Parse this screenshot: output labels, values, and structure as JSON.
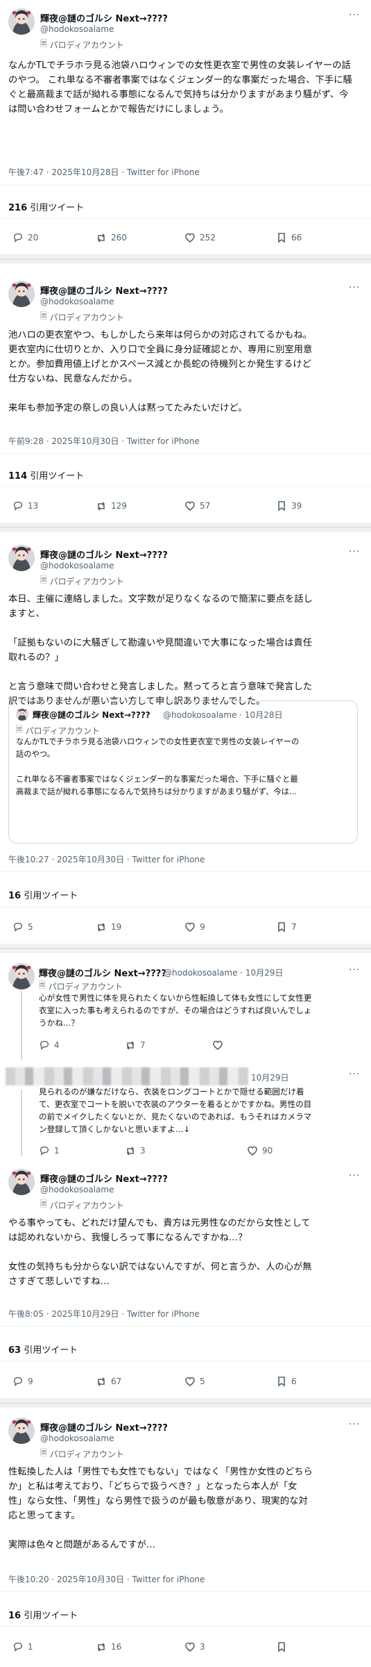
{
  "account": {
    "name": "輝夜@謎のゴルシ Next→????",
    "handle": "@hodokosoalame",
    "label": "パロディアカウント"
  },
  "tweets": [
    {
      "text": "なんかTLでチラホラ見る池袋ハロウィンでの女性更衣室で男性の女装レイヤーの話のやつ。\n\nこれ単なる不審者事案ではなくジェンダー的な事案だった場合、下手に騒ぐと最高裁まで話が拗れる事態になるんで気持ちは分かりますがあまり騒がず、今は問い合わせフォームとかで報告だけにしましょう。",
      "meta": "午後7:47 · 2025年10月28日 · Twitter for iPhone",
      "quotes_count": "216",
      "quotes_label": "引用ツイート",
      "replies": "20",
      "retweets": "260",
      "likes": "252",
      "bookmarks": "66"
    },
    {
      "text": "池ハロの更衣室やつ、もしかしたら来年は何らかの対応されてるかもね。\n更衣室内に仕切りとか、入り口で全員に身分証確認とか、専用に別室用意\nとか。参加費用値上げとかスペース減とか長蛇の待機列とか発生するけど\n仕方ないね、民意なんだから。\n\n来年も参加予定の祭しの良い人は黙ってたみたいだけど。",
      "meta": "午前9:28 · 2025年10月30日 · Twitter for iPhone",
      "quotes_count": "114",
      "quotes_label": "引用ツイート",
      "replies": "13",
      "retweets": "129",
      "likes": "57",
      "bookmarks": "39"
    },
    {
      "text": "本日、主催に連絡しました。文字数が足りなくなるので簡潔に要点を話し\nますと、\n\n「証拠もないのに大騒ぎして勘違いや見間違いで大事になった場合は責任\n取れるの？」\n\nと言う意味で問い合わせと発言しました。黙ってろと言う意味で発言した\n訳ではありませんが悪い言い方して申し訳ありませんでした。",
      "quoted": {
        "name": "輝夜@謎のゴルシ Next→????",
        "handle_date": "@hodokosoalame · 10月28日",
        "label": "パロディアカウント",
        "text": "なんかTLでチラホラ見る池袋ハロウィンでの女性更衣室で男性の女装レイヤーの\n話のやつ。\n\nこれ単なる不審者事案ではなくジェンダー的な事案だった場合、下手に騒ぐと最\n高裁まで話が拗れる事態になるんで気持ちは分かりますがあまり騒がず、今は..."
      },
      "meta": "午後10:27 · 2025年10月30日 · Twitter for iPhone",
      "quotes_count": "16",
      "quotes_label": "引用ツイート",
      "replies": "5",
      "retweets": "19",
      "likes": "9",
      "bookmarks": "7"
    },
    {
      "thread": [
        {
          "name": "輝夜@謎のゴルシ Next→????",
          "handle_date": "@hodokosoalame · 10月29日",
          "label": "パロディアカウント",
          "text": "心が女性で男性に体を見られたくないから性転換して体も女性にして女性更\n衣室に入った事も考えられるのですが、その場合はどうすれば良いんでしょ\nうかね…？",
          "replies": "4",
          "retweets": "7",
          "likes": ""
        },
        {
          "date": "10月29日",
          "text": "見られるのが嫌なだけなら、衣装をロングコートとかで隠せる範囲だけ着\nて、更衣室でコートを脱いで衣装のアウターを着るとかですかね。男性の目\nの前でメイクしたくないとか、見たくないのであれば、もうそれはカメラマ\nン登録して頂くしかないと思いますよ…↓",
          "replies": "1",
          "retweets": "3",
          "likes": "90"
        }
      ],
      "text": "やる事やっても、どれだけ望んでも、貴方は元男性なのだから女性として\nは認めれないから、我慢しろって事になるんですかね…？\n\n女性の気持ちも分からない訳ではないんですが、何と言うか、人の心が無\nさすぎて悲しいですね…",
      "meta": "午後8:05 · 2025年10月29日 · Twitter for iPhone",
      "quotes_count": "63",
      "quotes_label": "引用ツイート",
      "replies": "9",
      "retweets": "67",
      "likes": "5",
      "bookmarks": "6"
    },
    {
      "text": "性転換した人は「男性でも女性でもない」ではなく「男性か女性のどちら\nか」と私は考えており、「どちらで扱うべき？」となったら本人が「女\n性」なら女性、「男性」なら男性で扱うのが最も敬意があり、現実的な対\n応と思ってます。\n\n実際は色々と問題があるんですが…",
      "meta": "午後10:20 · 2025年10月30日 · Twitter for iPhone",
      "quotes_count": "16",
      "quotes_label": "引用ツイート",
      "replies": "1",
      "retweets": "16",
      "likes": "3",
      "bookmarks": ""
    }
  ]
}
